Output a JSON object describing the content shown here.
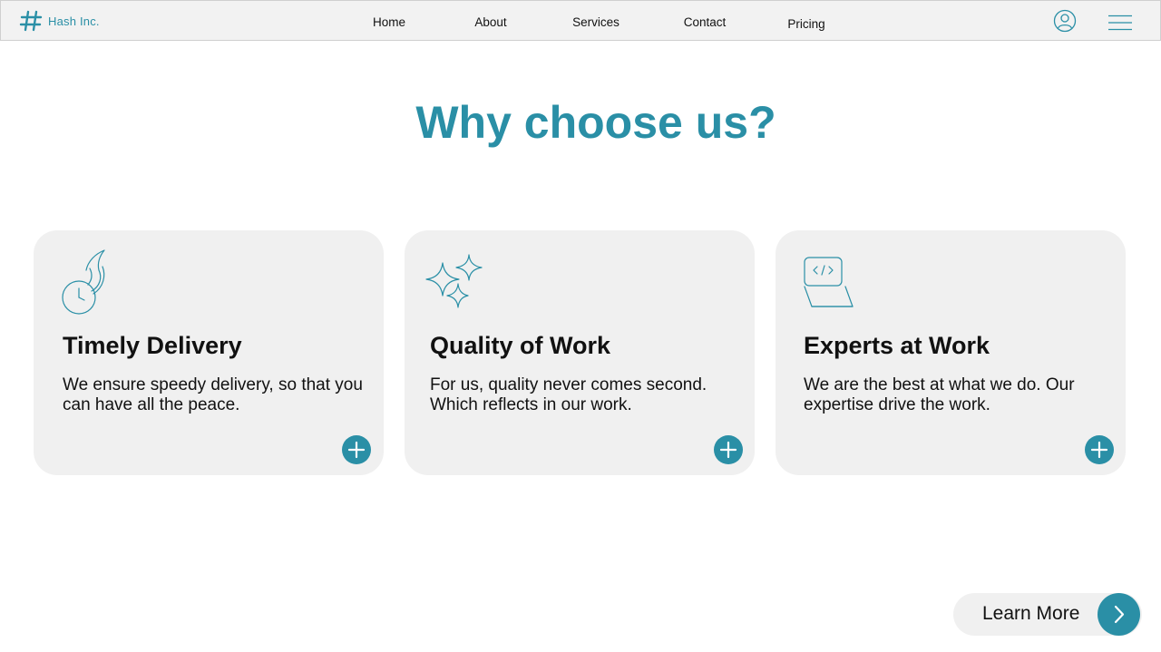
{
  "colors": {
    "accent": "#2a8fa6",
    "navbar_bg": "#f2f2f2",
    "card_bg": "#f0f0f0",
    "text": "#111111"
  },
  "navbar": {
    "brand_icon": "hash-icon",
    "brand_name": "Hash Inc.",
    "links": [
      "Home",
      "About",
      "Services",
      "Contact",
      "Pricing"
    ],
    "profile_icon": "user-circle-icon",
    "menu_icon": "hamburger-menu-icon"
  },
  "main": {
    "heading": "Why choose us?",
    "cards": [
      {
        "icon": "flaming-clock-icon",
        "title": "Timely Delivery",
        "description": "We ensure speedy delivery, so that you can have all the peace.",
        "action_icon": "plus-icon"
      },
      {
        "icon": "sparkles-icon",
        "title": "Quality of Work",
        "description": "For us, quality never comes second. Which reflects in our work.",
        "action_icon": "plus-icon"
      },
      {
        "icon": "laptop-code-icon",
        "title": "Experts at Work",
        "description": "We are the best at what we do. Our expertise drive the work.",
        "action_icon": "plus-icon"
      }
    ],
    "learn_more": {
      "label": "Learn More",
      "icon": "chevron-right-icon"
    }
  }
}
